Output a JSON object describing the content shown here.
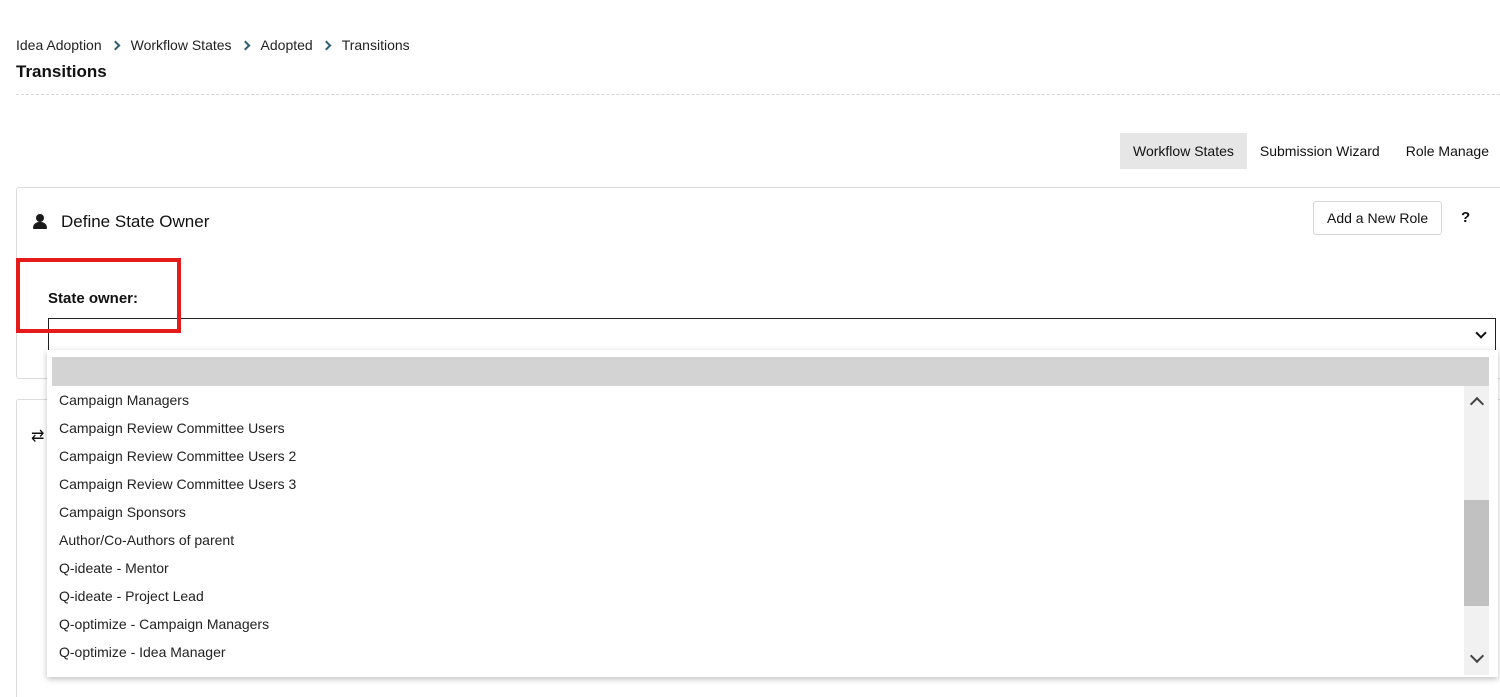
{
  "breadcrumb": [
    "Idea Adoption",
    "Workflow States",
    "Adopted",
    "Transitions"
  ],
  "page_title": "Transitions",
  "tabs": [
    "Workflow States",
    "Submission Wizard",
    "Role Manage"
  ],
  "active_tab": "Workflow States",
  "state_owner_card": {
    "icon": "user-icon",
    "title": "Define State Owner",
    "add_role_label": "Add a New Role",
    "help_label": "?",
    "field_label": "State owner:",
    "selected_value": ""
  },
  "transitions_card": {
    "icon": "transfer-arrows-icon",
    "icon_glyph": "⇄"
  },
  "dropdown": {
    "options": [
      "Campaign Managers",
      "Campaign Review Committee Users",
      "Campaign Review Committee Users 2",
      "Campaign Review Committee Users 3",
      "Campaign Sponsors",
      "Author/Co-Authors of parent",
      "Q-ideate - Mentor",
      "Q-ideate - Project Lead",
      "Q-optimize - Campaign Managers",
      "Q-optimize - Idea Manager"
    ]
  },
  "colors": {
    "highlight": "#e51b1b",
    "breadcrumb_separator": "#2b5f7a",
    "active_tab_bg": "#e6e6e6",
    "blank_option_bg": "#d3d3d3"
  }
}
